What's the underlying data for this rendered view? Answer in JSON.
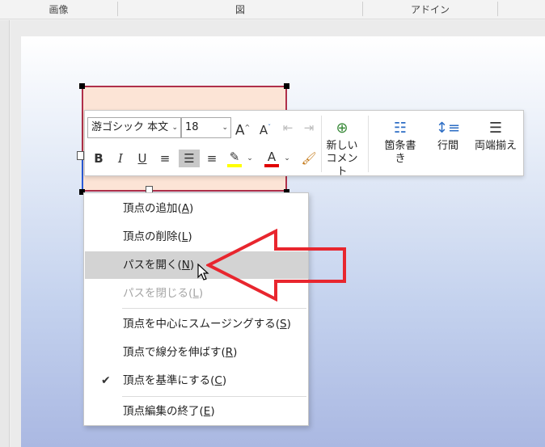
{
  "ribbon": {
    "groups": [
      "画像",
      "図",
      "アドイン"
    ]
  },
  "toolbar": {
    "font_name": "游ゴシック 本文",
    "font_size": "18",
    "grow_font": "A",
    "shrink_font": "A",
    "bold": "B",
    "italic": "I",
    "underline": "U",
    "font_color": "A",
    "new_comment_line1": "新しい",
    "new_comment_line2": "コメント",
    "bullets_line1": "箇条書",
    "bullets_line2": "き",
    "line_spacing": "行間",
    "justify": "両端揃え"
  },
  "colors": {
    "highlight": "#ffff00",
    "font_color": "#e00000",
    "shape_fill": "#fce4d6",
    "shape_border": "#b0304a",
    "arrow": "#e8262e"
  },
  "context_menu": {
    "items": [
      {
        "text": "頂点の追加(",
        "key": "A",
        "close": ")"
      },
      {
        "text": "頂点の削除(",
        "key": "L",
        "close": ")"
      },
      {
        "text": "パスを開く(",
        "key": "N",
        "close": ")"
      },
      {
        "text": "パスを閉じる(",
        "key": "L",
        "close": ")"
      },
      {
        "text": "頂点を中心にスムージングする(",
        "key": "S",
        "close": ")"
      },
      {
        "text": "頂点で線分を伸ばす(",
        "key": "R",
        "close": ")"
      },
      {
        "text": "頂点を基準にする(",
        "key": "C",
        "close": ")"
      },
      {
        "text": "頂点編集の終了(",
        "key": "E",
        "close": ")"
      }
    ],
    "highlighted_index": 2,
    "disabled_index": 3,
    "checked_index": 6,
    "check_mark": "✔"
  }
}
